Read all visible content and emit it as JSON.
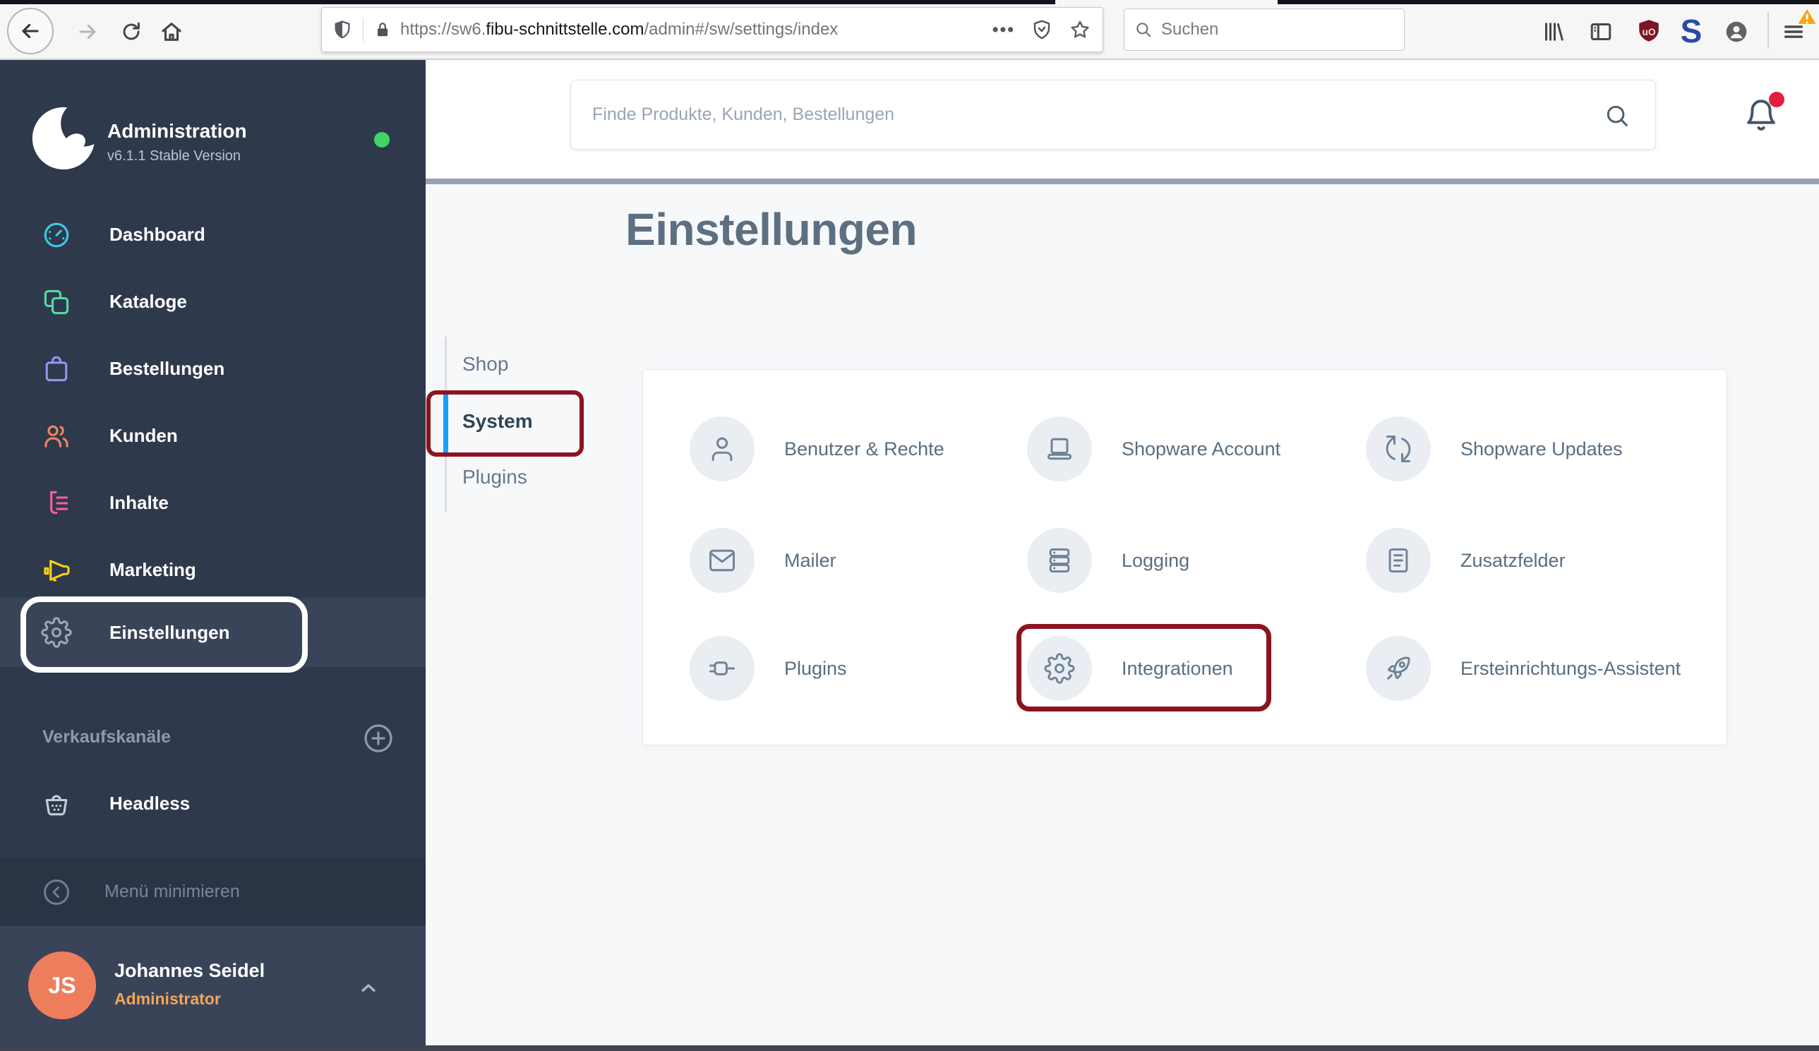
{
  "browser": {
    "url": {
      "prefix": "https://sw6.",
      "domain": "fibu-schnittstelle.com",
      "path": "/admin#/sw/settings/index"
    },
    "search_placeholder": "Suchen",
    "overflow_dots": "•••",
    "ublock_label": "uO",
    "s_extension_label": "S"
  },
  "sidebar": {
    "title": "Administration",
    "version": "v6.1.1 Stable Version",
    "items": [
      {
        "label": "Dashboard"
      },
      {
        "label": "Kataloge"
      },
      {
        "label": "Bestellungen"
      },
      {
        "label": "Kunden"
      },
      {
        "label": "Inhalte"
      },
      {
        "label": "Marketing"
      },
      {
        "label": "Einstellungen"
      }
    ],
    "active_item": "Einstellungen",
    "sales_channels_label": "Verkaufskanäle",
    "channels": [
      {
        "label": "Headless"
      }
    ],
    "minimize_label": "Menü minimieren",
    "user": {
      "initials": "JS",
      "name": "Johannes Seidel",
      "role": "Administrator"
    }
  },
  "header": {
    "search_placeholder": "Finde Produkte, Kunden, Bestellungen"
  },
  "page": {
    "title": "Einstellungen",
    "tabs": [
      {
        "label": "Shop"
      },
      {
        "label": "System"
      },
      {
        "label": "Plugins"
      }
    ],
    "active_tab": "System",
    "items": [
      {
        "label": "Benutzer & Rechte"
      },
      {
        "label": "Shopware Account"
      },
      {
        "label": "Shopware Updates"
      },
      {
        "label": "Mailer"
      },
      {
        "label": "Logging"
      },
      {
        "label": "Zusatzfelder"
      },
      {
        "label": "Plugins"
      },
      {
        "label": "Integrationen"
      },
      {
        "label": "Ersteinrichtungs-Assistent"
      }
    ],
    "highlighted_item": "Integrationen"
  },
  "colors": {
    "sidebar_bg": "#2f394c",
    "sidebar_active_bg": "#3a4458",
    "annotation_red": "#8c1420",
    "annotation_white": "#ffffff",
    "tab_active_blue": "#189eff",
    "notification_red": "#e41e3f",
    "avatar_orange": "#ee7d5c",
    "role_orange": "#f2a65a",
    "online_green": "#41d464"
  }
}
